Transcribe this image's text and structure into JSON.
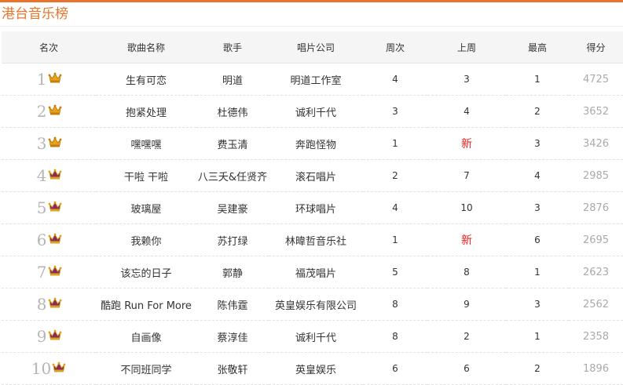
{
  "page": {
    "title": "港台音乐榜"
  },
  "colors": {
    "accent": "#e9742b",
    "gold_crown": "#e6a31b",
    "purple_crown": "#8a2a58",
    "new_marker": "#e02020"
  },
  "headers": [
    "名次",
    "歌曲名称",
    "歌手",
    "唱片公司",
    "周次",
    "上周",
    "最高",
    "得分"
  ],
  "rows": [
    {
      "rank": "1",
      "crown": "gold-crown-icon",
      "song": "生有可恋",
      "artist": "明道",
      "label": "明道工作室",
      "weeks": "4",
      "last": "3",
      "peak": "1",
      "score": "4725"
    },
    {
      "rank": "2",
      "crown": "gold-crown-icon",
      "song": "抱紧处理",
      "artist": "杜德伟",
      "label": "诚利千代",
      "weeks": "3",
      "last": "4",
      "peak": "2",
      "score": "3652"
    },
    {
      "rank": "3",
      "crown": "gold-crown-icon",
      "song": "嘿嘿嘿",
      "artist": "费玉清",
      "label": "奔跑怪物",
      "weeks": "1",
      "last": "新",
      "peak": "3",
      "score": "3426"
    },
    {
      "rank": "4",
      "crown": "purple-crown-icon",
      "song": "干啦 干啦",
      "artist": "八三夭&任贤齐",
      "label": "滚石唱片",
      "weeks": "2",
      "last": "7",
      "peak": "4",
      "score": "2985"
    },
    {
      "rank": "5",
      "crown": "purple-crown-icon",
      "song": "玻璃屋",
      "artist": "吴建豪",
      "label": "环球唱片",
      "weeks": "4",
      "last": "10",
      "peak": "3",
      "score": "2876"
    },
    {
      "rank": "6",
      "crown": "purple-crown-icon",
      "song": "我赖你",
      "artist": "苏打绿",
      "label": "林暐哲音乐社",
      "weeks": "1",
      "last": "新",
      "peak": "6",
      "score": "2695"
    },
    {
      "rank": "7",
      "crown": "purple-crown-icon",
      "song": "该忘的日子",
      "artist": "郭静",
      "label": "福茂唱片",
      "weeks": "5",
      "last": "8",
      "peak": "1",
      "score": "2623"
    },
    {
      "rank": "8",
      "crown": "purple-crown-icon",
      "song": "酷跑 Run For More",
      "artist": "陈伟霆",
      "label": "英皇娱乐有限公司",
      "weeks": "8",
      "last": "9",
      "peak": "3",
      "score": "2562"
    },
    {
      "rank": "9",
      "crown": "purple-crown-icon",
      "song": "自画像",
      "artist": "蔡淳佳",
      "label": "诚利千代",
      "weeks": "8",
      "last": "2",
      "peak": "1",
      "score": "2358"
    },
    {
      "rank": "10",
      "crown": "purple-crown-icon",
      "song": "不同班同学",
      "artist": "张敬轩",
      "label": "英皇娱乐",
      "weeks": "6",
      "last": "6",
      "peak": "2",
      "score": "1896"
    }
  ]
}
